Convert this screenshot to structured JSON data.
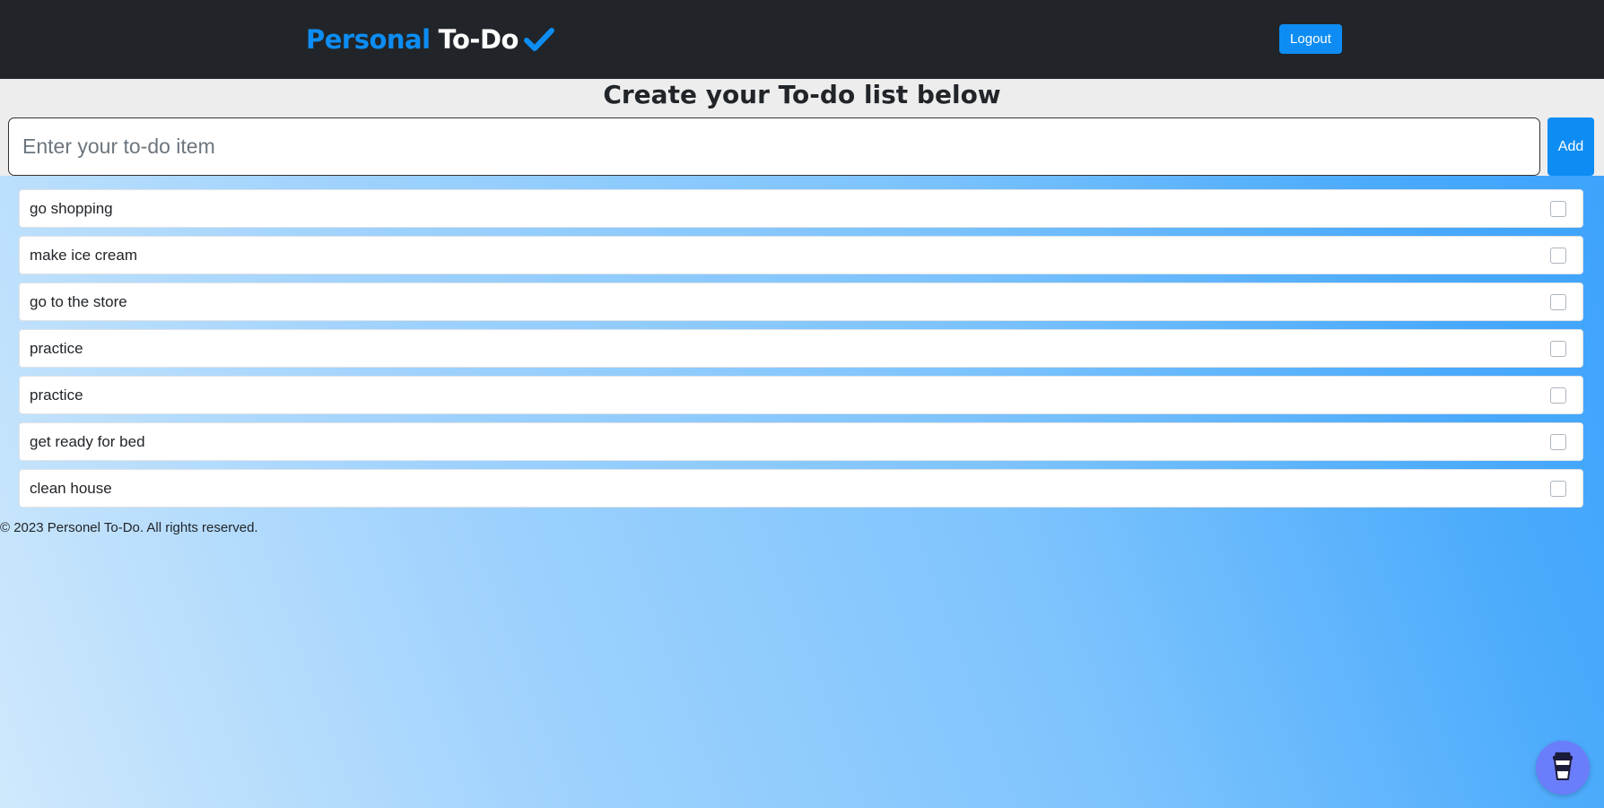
{
  "header": {
    "brand_part1": "Personal",
    "brand_part2": "To-Do",
    "brand_icon": "checkmark-icon",
    "logout_label": "Logout"
  },
  "create": {
    "title": "Create your To-do list below",
    "input_placeholder": "Enter your to-do item",
    "input_value": "",
    "add_label": "Add"
  },
  "todos": [
    {
      "text": "go shopping",
      "checked": false
    },
    {
      "text": "make ice cream",
      "checked": false
    },
    {
      "text": "go to the store",
      "checked": false
    },
    {
      "text": "practice",
      "checked": false
    },
    {
      "text": "practice",
      "checked": false
    },
    {
      "text": "get ready for bed",
      "checked": false
    },
    {
      "text": "clean house",
      "checked": false
    }
  ],
  "footer": {
    "text": "© 2023 Personel To-Do. All rights reserved."
  },
  "floating": {
    "icon": "coffee-cup-icon"
  },
  "colors": {
    "accent": "#0d8df3",
    "navbar": "#212529",
    "coffee_button": "#6a7dfb"
  }
}
